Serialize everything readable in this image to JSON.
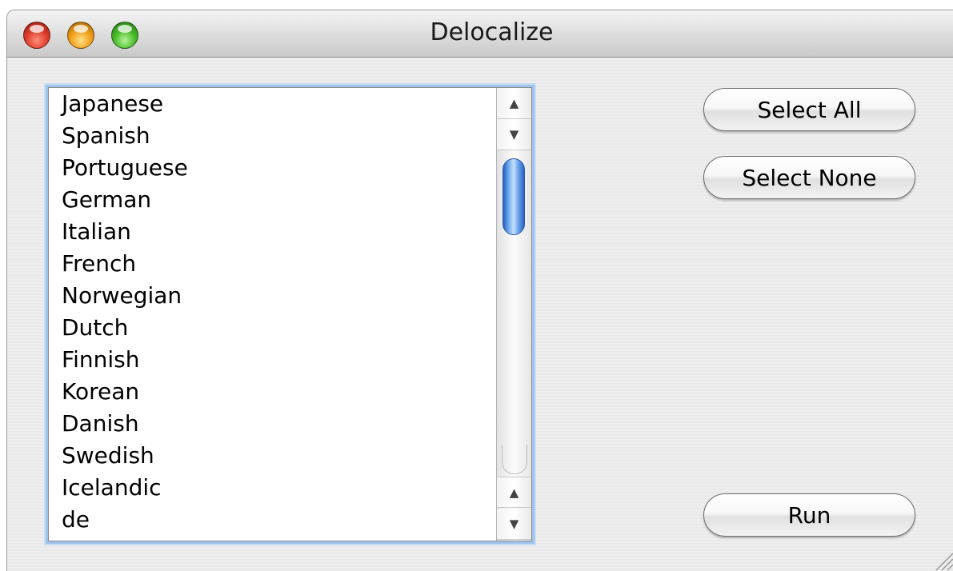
{
  "window": {
    "title": "Delocalize"
  },
  "languages": {
    "items": [
      "Japanese",
      "Spanish",
      "Portuguese",
      "German",
      "Italian",
      "French",
      "Norwegian",
      "Dutch",
      "Finnish",
      "Korean",
      "Danish",
      "Swedish",
      "Icelandic",
      "de"
    ]
  },
  "buttons": {
    "select_all": "Select All",
    "select_none": "Select None",
    "run": "Run"
  },
  "scrollbar": {
    "up_arrow": "▲",
    "down_arrow": "▼"
  },
  "colors": {
    "focus_ring": "#9ec3ec",
    "scroll_thumb": "#3b7ad9"
  }
}
